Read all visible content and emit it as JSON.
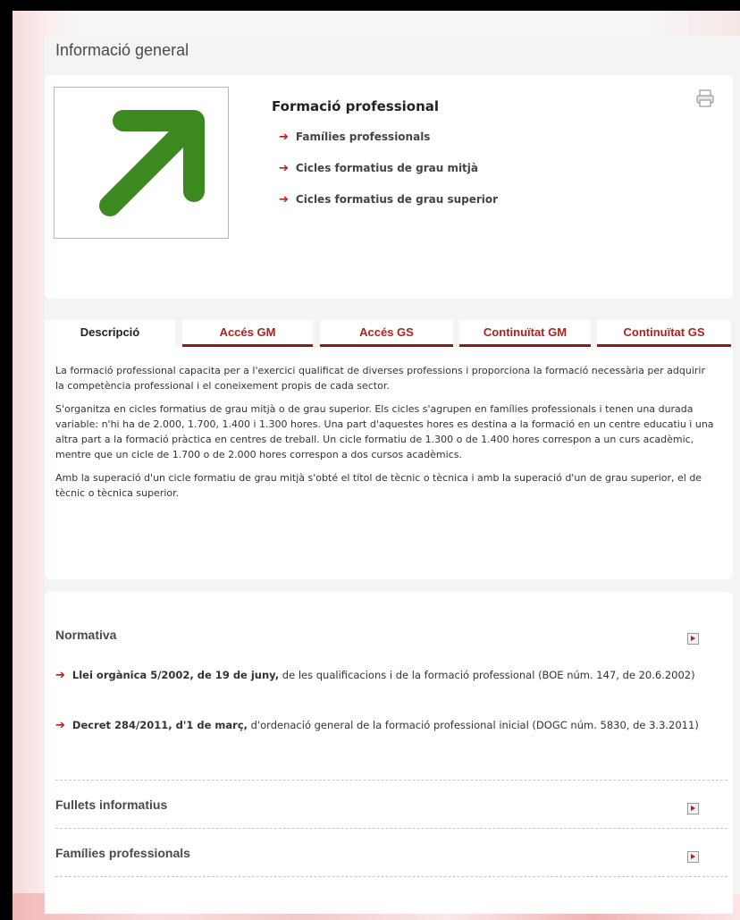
{
  "page_title": "Informació general",
  "intro": {
    "title": "Formació professional",
    "links": [
      "Famílies professionals",
      "Cicles formatius de grau mitjà",
      "Cicles formatius de grau superior"
    ],
    "arrow_glyph": "➔"
  },
  "tabs": [
    {
      "label": "Descripció",
      "active": true
    },
    {
      "label": "Accés GM",
      "active": false
    },
    {
      "label": "Accés GS",
      "active": false
    },
    {
      "label": "Continuïtat GM",
      "active": false
    },
    {
      "label": "Continuïtat GS",
      "active": false
    }
  ],
  "description": {
    "p1": "La formació professional capacita per a l'exercici qualificat de diverses professions i proporciona la formació necessària per adquirir la competència professional i el coneixement propis de cada sector.",
    "p2": "S'organitza en cicles formatius de grau mitjà o de grau superior. Els cicles s'agrupen en famílies professionals i tenen una durada variable: n'hi ha de 2.000, 1.700, 1.400 i 1.300 hores. Una part d'aquestes hores es destina a la formació en un centre educatiu i una altra part a la formació pràctica en centres de treball. Un cicle formatiu de 1.300 o de 1.400 hores correspon a un curs acadèmic, mentre que un cicle de 1.700 o de 2.000 hores correspon a dos cursos acadèmics.",
    "p3": "Amb la superació d'un cicle formatiu de grau mitjà s'obté el títol de tècnic o tècnica i amb la superació d'un de grau superior, el de tècnic o tècnica superior."
  },
  "sections": {
    "normativa": {
      "title": "Normativa",
      "items": [
        {
          "bold": "Llei orgànica 5/2002, de 19 de juny,",
          "rest": " de les qualificacions i de la formació professional (BOE núm. 147, de 20.6.2002)"
        },
        {
          "bold": "Decret 284/2011, d'1 de març,",
          "rest": " d'ordenació general de la formació professional inicial (DOGC núm. 5830, de 3.3.2011)"
        }
      ]
    },
    "fullets": {
      "title": "Fullets informatius"
    },
    "families": {
      "title": "Famílies professionals"
    }
  },
  "colors": {
    "accent": "#b3201c",
    "tab_underline": "#8c1b16",
    "logo_arrow": "#3c8a1f"
  },
  "icons": {
    "print": "printer-icon",
    "expand": "expand-arrow-icon",
    "logo": "green-diagonal-arrow-icon"
  }
}
